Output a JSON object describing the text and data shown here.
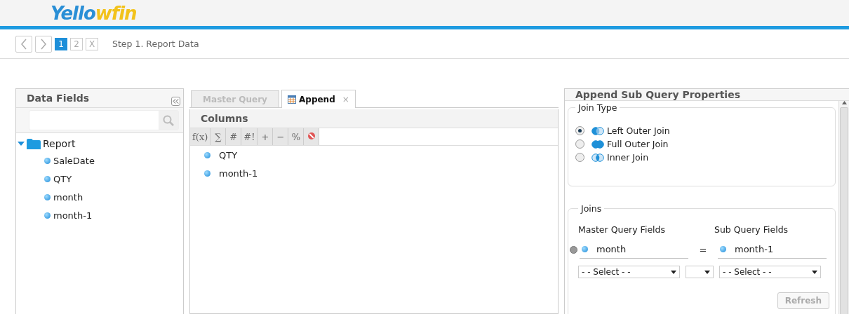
{
  "logo": "Yellowfin",
  "nav": {
    "steps": [
      {
        "label": "1",
        "selected": true
      },
      {
        "label": "2",
        "selected": false
      },
      {
        "label": "X",
        "selected": false
      }
    ],
    "title": "Step 1. Report Data"
  },
  "data_fields": {
    "title": "Data Fields",
    "tree": [
      {
        "label": "Report",
        "expanded": true,
        "children": [
          {
            "label": "SaleDate"
          },
          {
            "label": "QTY"
          },
          {
            "label": "month"
          },
          {
            "label": "month-1"
          }
        ]
      }
    ]
  },
  "query_tabs": [
    {
      "label": "Master Query",
      "selected": false
    },
    {
      "label": "Append",
      "selected": true,
      "close": "×"
    }
  ],
  "columns": {
    "title": "Columns",
    "tools": [
      "f(x)",
      "∑",
      "#",
      "#!",
      "+",
      "−",
      "%"
    ],
    "items": [
      "QTY",
      "month-1"
    ]
  },
  "properties": {
    "title": "Append Sub Query Properties",
    "join_type": {
      "legend": "Join Type",
      "options": [
        {
          "label": "Left Outer Join",
          "selected": true,
          "kind": "left"
        },
        {
          "label": "Full Outer Join",
          "selected": false,
          "kind": "full"
        },
        {
          "label": "Inner Join",
          "selected": false,
          "kind": "inner"
        }
      ]
    },
    "joins": {
      "legend": "Joins",
      "master_header": "Master Query Fields",
      "sub_header": "Sub Query Fields",
      "rows": [
        {
          "master": "month",
          "operator": "=",
          "sub": "month-1"
        }
      ],
      "master_select": "- - Select - -",
      "sub_select": "- - Select - -",
      "refresh": "Refresh"
    }
  }
}
